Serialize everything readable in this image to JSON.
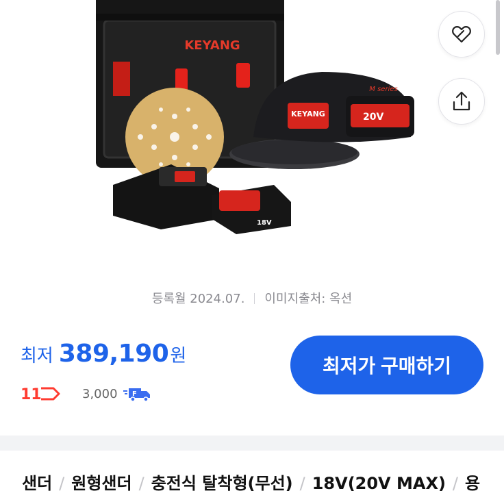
{
  "product_image": {
    "brand_text": "KEYANG",
    "series_text": "M series",
    "battery_label": "20V",
    "small_battery_label": "18V"
  },
  "actions": {
    "like_icon": "heart-link-icon",
    "share_icon": "share-upload-icon"
  },
  "meta": {
    "registered": "등록월 2024.07.",
    "image_source": "이미지출처: 옥션"
  },
  "price": {
    "label": "최저",
    "value": "389,190",
    "unit": "원"
  },
  "buy_button": {
    "label": "최저가 구매하기"
  },
  "seller": {
    "logo_text": "11",
    "shipping_fee": "3,000",
    "shipping_icon": "delivery-truck-icon"
  },
  "breadcrumbs": [
    "샌더",
    "원형샌더",
    "충전식 탈착형(무선)",
    "18V(20V MAX)",
    "용"
  ],
  "colors": {
    "accent": "#1e63e9",
    "seller_red": "#ff3b30"
  }
}
